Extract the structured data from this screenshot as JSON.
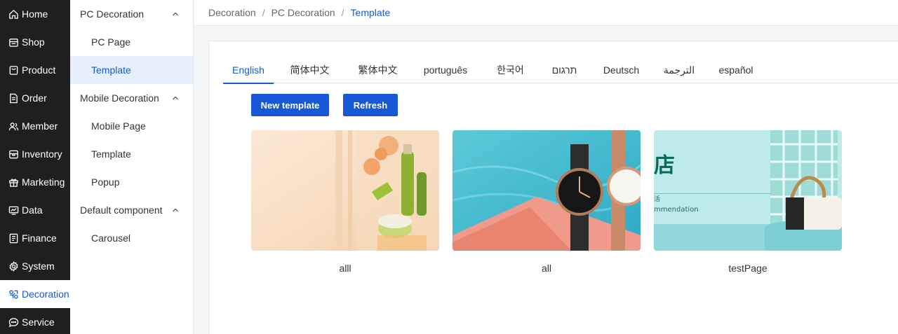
{
  "nav": {
    "items": [
      {
        "label": "Home",
        "icon": "home-icon"
      },
      {
        "label": "Shop",
        "icon": "shop-icon"
      },
      {
        "label": "Product",
        "icon": "product-icon"
      },
      {
        "label": "Order",
        "icon": "order-icon"
      },
      {
        "label": "Member",
        "icon": "member-icon"
      },
      {
        "label": "Inventory",
        "icon": "inventory-icon"
      },
      {
        "label": "Marketing",
        "icon": "gift-icon"
      },
      {
        "label": "Data",
        "icon": "chart-icon"
      },
      {
        "label": "Finance",
        "icon": "finance-icon"
      },
      {
        "label": "System",
        "icon": "gear-icon"
      },
      {
        "label": "Decoration",
        "icon": "decoration-icon"
      },
      {
        "label": "Service",
        "icon": "chat-icon"
      }
    ],
    "active_index": 10
  },
  "subnav": {
    "groups": [
      {
        "label": "PC Decoration",
        "items": [
          "PC Page",
          "Template"
        ]
      },
      {
        "label": "Mobile Decoration",
        "items": [
          "Mobile Page",
          "Template",
          "Popup"
        ]
      },
      {
        "label": "Default component",
        "items": [
          "Carousel"
        ]
      }
    ]
  },
  "breadcrumb": {
    "items": [
      "Decoration",
      "PC Decoration",
      "Template"
    ],
    "separator": "/"
  },
  "tabs": {
    "items": [
      "English",
      "简体中文",
      "繁体中文",
      "português",
      "한국어",
      "תרגום",
      "Deutsch",
      "الترجمة",
      "español"
    ],
    "active_index": 0
  },
  "toolbar": {
    "new_label": "New template",
    "refresh_label": "Refresh"
  },
  "templates": [
    {
      "name": "alll"
    },
    {
      "name": "all"
    },
    {
      "name": "testPage",
      "thumb_text": "店",
      "thumb_sub1": "活",
      "thumb_sub2": "mmendation"
    }
  ],
  "colors": {
    "accent": "#1559d6",
    "nav_bg": "#1f1f1f",
    "subnav_active_bg": "#e7eefc"
  }
}
